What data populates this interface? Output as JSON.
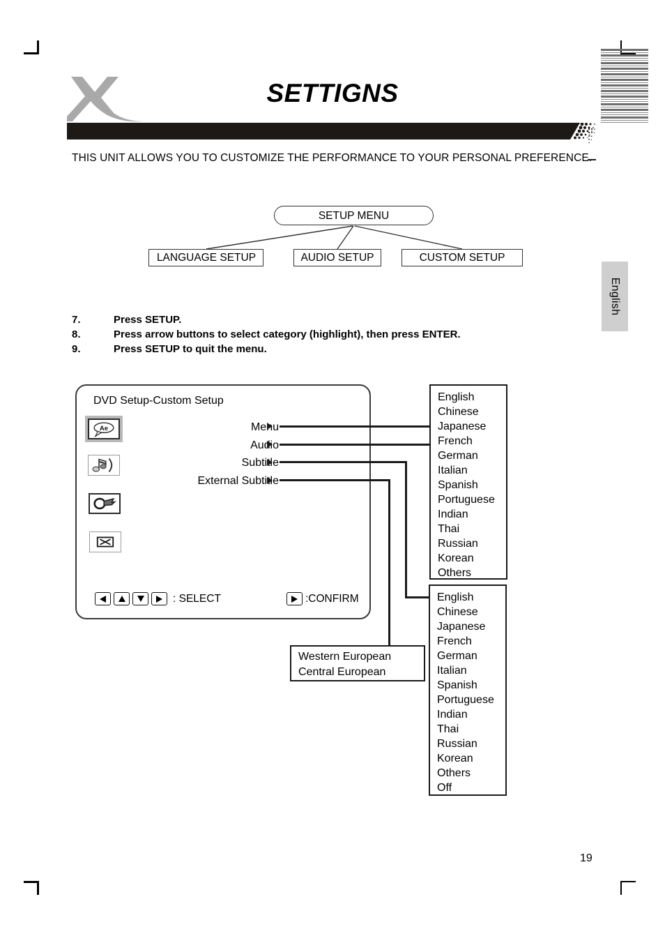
{
  "header": {
    "title": "SETTIGNS",
    "logo_icon": "x-swoosh-logo"
  },
  "intro": "THIS UNIT ALLOWS YOU TO CUSTOMIZE THE PERFORMANCE TO YOUR PERSONAL PREFERENCE.",
  "tree": {
    "root": "SETUP MENU",
    "children": [
      "LANGUAGE SETUP",
      "AUDIO SETUP",
      "CUSTOM SETUP"
    ]
  },
  "steps": [
    {
      "num": "7.",
      "text": "Press SETUP."
    },
    {
      "num": "8.",
      "text": "Press arrow buttons to select category (highlight), then press ENTER."
    },
    {
      "num": "9.",
      "text": "Press SETUP to quit the menu."
    }
  ],
  "dvd_screen": {
    "title": "DVD Setup-Custom Setup",
    "icons": [
      {
        "name": "language-bubble-icon",
        "glyph": "Ae",
        "selected": true
      },
      {
        "name": "audio-note-icon",
        "glyph": "note",
        "selected": false
      },
      {
        "name": "lock-key-icon",
        "glyph": "key",
        "selected": false
      },
      {
        "name": "exit-x-icon",
        "glyph": "X",
        "selected": false
      }
    ],
    "menu_items": [
      "Menu",
      "Audio",
      "Subtitle",
      "External Subtitle"
    ],
    "footer": {
      "select_label": ": SELECT",
      "confirm_label": ":CONFIRM",
      "keys": [
        "arrow-left",
        "arrow-up",
        "arrow-down",
        "arrow-right"
      ],
      "confirm_key": "play-right"
    }
  },
  "language_list_a": [
    "English",
    "Chinese",
    "Japanese",
    "French",
    "German",
    "Italian",
    "Spanish",
    "Portuguese",
    "Indian",
    "Thai",
    "Russian",
    "Korean",
    "Others"
  ],
  "language_list_b": [
    "English",
    "Chinese",
    "Japanese",
    "French",
    "German",
    "Italian",
    "Spanish",
    "Portuguese",
    "Indian",
    "Thai",
    "Russian",
    "Korean",
    "Others",
    "Off"
  ],
  "encoding_list": [
    "Western European",
    "Central European"
  ],
  "side_tab": "English",
  "page_number": "19",
  "colors": {
    "bar": "#1c1916",
    "logo": "#a9a9a9",
    "tab_bg": "#cfcfcf",
    "selected_icon_bg": "#b9b9b9"
  }
}
